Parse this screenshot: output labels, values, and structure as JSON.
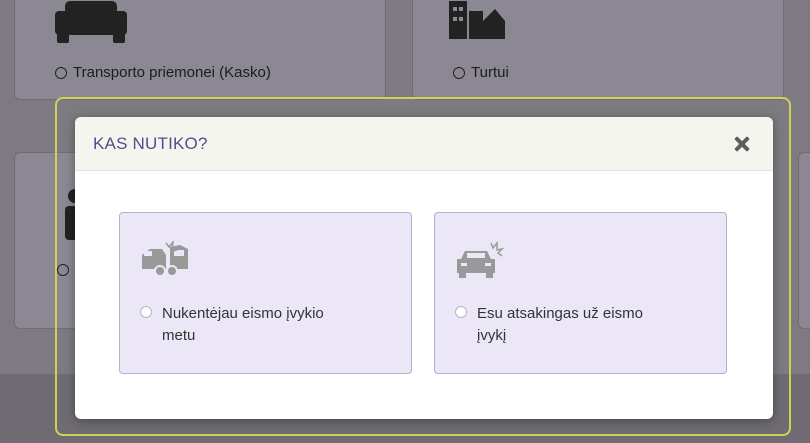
{
  "background": {
    "cards": [
      {
        "label": "Transporto priemonei (Kasko)",
        "icon": "car-icon"
      },
      {
        "label": "Turtui",
        "icon": "buildings-icon"
      },
      {
        "label": "",
        "icon": "person-icon"
      }
    ]
  },
  "modal": {
    "title": "KAS NUTIKO?",
    "close_icon": "close-icon",
    "options": [
      {
        "label": "Nukentėjau eismo įvykio metu",
        "icon": "car-collision-icon"
      },
      {
        "label": "Esu atsakingas už eismo įvykį",
        "icon": "car-crash-icon"
      }
    ]
  },
  "colors": {
    "accent": "#5a4a8c",
    "option_bg": "#ebe7f7",
    "focus_ring": "#d2cf56",
    "overlay": "#7d7b81"
  }
}
